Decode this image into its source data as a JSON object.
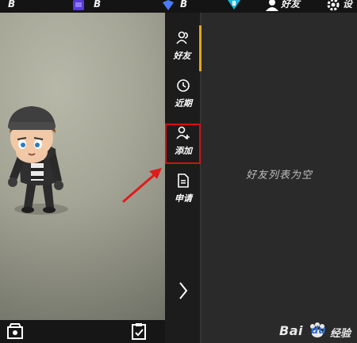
{
  "topbar": {
    "label_b1": "B",
    "label_b2": "B",
    "label_b3": "B",
    "friends_label": "好友",
    "settings_label": "设"
  },
  "sidenav": {
    "items": [
      {
        "label": "好友",
        "icon": "friends-icon",
        "active": true
      },
      {
        "label": "近期",
        "icon": "recent-clock-icon",
        "active": false
      },
      {
        "label": "添加",
        "icon": "add-friend-icon",
        "active": false
      },
      {
        "label": "申请",
        "icon": "request-document-icon",
        "active": false
      }
    ],
    "expand_icon": "chevron-right-icon"
  },
  "right_panel": {
    "empty_text": "好友列表为空"
  },
  "bottom_bar": {
    "left_icon": "shop-icon",
    "right_icon": "tasks-clipboard-icon"
  },
  "colors": {
    "accent": "#e3a51e",
    "highlight": "#d50f10",
    "panel_bg": "#2a2a2a",
    "nav_bg": "#1c1c1c"
  },
  "watermark": {
    "text_left": "Bai",
    "text_mid": "du",
    "text_right": "经验"
  }
}
